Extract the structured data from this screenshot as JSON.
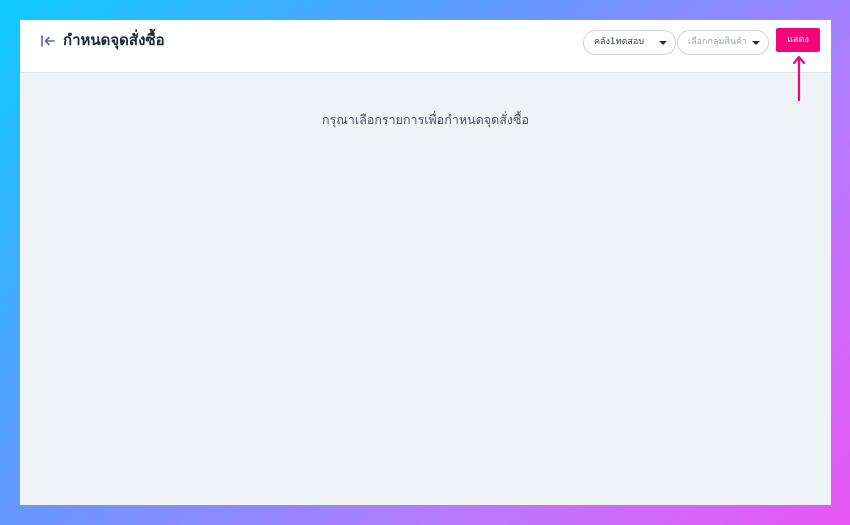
{
  "header": {
    "back_icon": "collapse-left-arrow-icon",
    "title": "กำหนดจุดสั่งซื้อ"
  },
  "filters": {
    "warehouse": {
      "value": "คลัง1ทดสอบ",
      "icon": "caret-down-icon"
    },
    "product_group": {
      "placeholder": "เลือกกลุ่มสินค้า",
      "icon": "caret-down-icon"
    },
    "show_label": "แสดง"
  },
  "main": {
    "empty_message": "กรุณาเลือกรายการเพื่อกำหนดจุดสั่งซื้อ"
  },
  "colors": {
    "accent": "#f4067b",
    "header_bg": "#ffffff",
    "content_bg": "#eff2f7",
    "title_text": "#1f2937",
    "annotation_arrow": "#f4067b"
  }
}
